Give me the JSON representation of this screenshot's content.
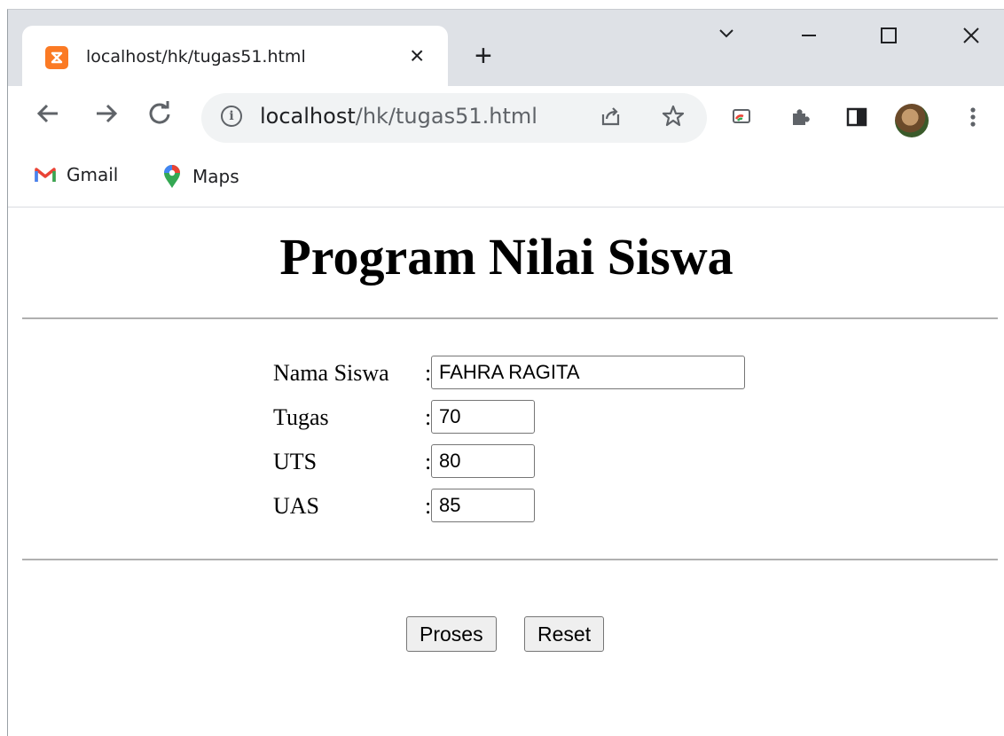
{
  "browser": {
    "tab_title": "localhost/hk/tugas51.html",
    "url_host": "localhost",
    "url_path": "/hk/tugas51.html",
    "bookmarks": [
      "Gmail",
      "Maps"
    ],
    "colors": {
      "titlebar": "#dee1e6",
      "favicon": "#fb7a24"
    }
  },
  "page": {
    "title": "Program Nilai Siswa",
    "fields": [
      {
        "label": "Nama Siswa",
        "value": "FAHRA RAGITA"
      },
      {
        "label": "Tugas",
        "value": "70"
      },
      {
        "label": "UTS",
        "value": "80"
      },
      {
        "label": "UAS",
        "value": "85"
      }
    ],
    "separator": ":",
    "buttons": {
      "process": "Proses",
      "reset": "Reset"
    }
  }
}
